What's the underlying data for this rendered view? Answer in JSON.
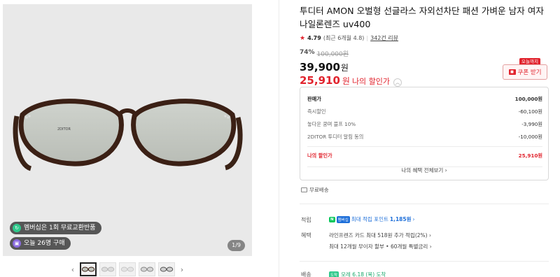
{
  "gallery": {
    "chip_membership": "멤버십은 1회 무료교환반품",
    "chip_purchases": "오늘 26명 구매",
    "counter": "1/9",
    "prev_arrow": "‹",
    "next_arrow": "›",
    "lens_brand_text": "2DITOR",
    "thumbnail_count": 5
  },
  "product": {
    "title": "투디터 AMON 오벌형 선글라스 자외선차단 패션 가벼운 남자 여자 나일론렌즈 uv400",
    "rating_score": "4.79",
    "rating_recent": "(최근 6개월 4.8)",
    "review_count": "342건 리뷰",
    "discount_pct": "74%",
    "original_price": "100,000원",
    "price": "39,900",
    "price_unit": "원",
    "my_price": "25,910",
    "my_price_unit": "원",
    "my_price_label": "나의 할인가",
    "coupon_tag": "오늘까지",
    "coupon_label": "쿠폰 받기"
  },
  "breakdown": {
    "rows": [
      {
        "label": "판매가",
        "value": "100,000원"
      },
      {
        "label": "즉시할인",
        "value": "-60,100원"
      },
      {
        "label": "놓다운 쿵며 블프 10%",
        "value": "-3,990원"
      },
      {
        "label": "2DITOR 투디터 알림 동의",
        "value": "-10,000원"
      }
    ],
    "mine_label": "나의 할인가",
    "mine_value": "25,910원",
    "link": "나의 혜택 전체보기 ›"
  },
  "shipping_free": "무료배송",
  "points": {
    "label": "적립",
    "npay": "N",
    "plus": "멤버십",
    "text": "최대 적립 포인트",
    "amount": "1,185원",
    "arrow": "›"
  },
  "benefit": {
    "label": "혜택",
    "line1": "라인프렌즈 카드 최대 518원 추가 적립(2%) ›",
    "line2": "최대 12개월 무이자 할부 • 60개월 특별금리 ›"
  },
  "delivery": {
    "label": "배송",
    "badge": "도착",
    "text": "모레 6.18 (목) 도착"
  },
  "colors": {
    "accent_red": "#e1232d",
    "point_blue": "#1e6fd9",
    "naver_green": "#03c75a"
  }
}
